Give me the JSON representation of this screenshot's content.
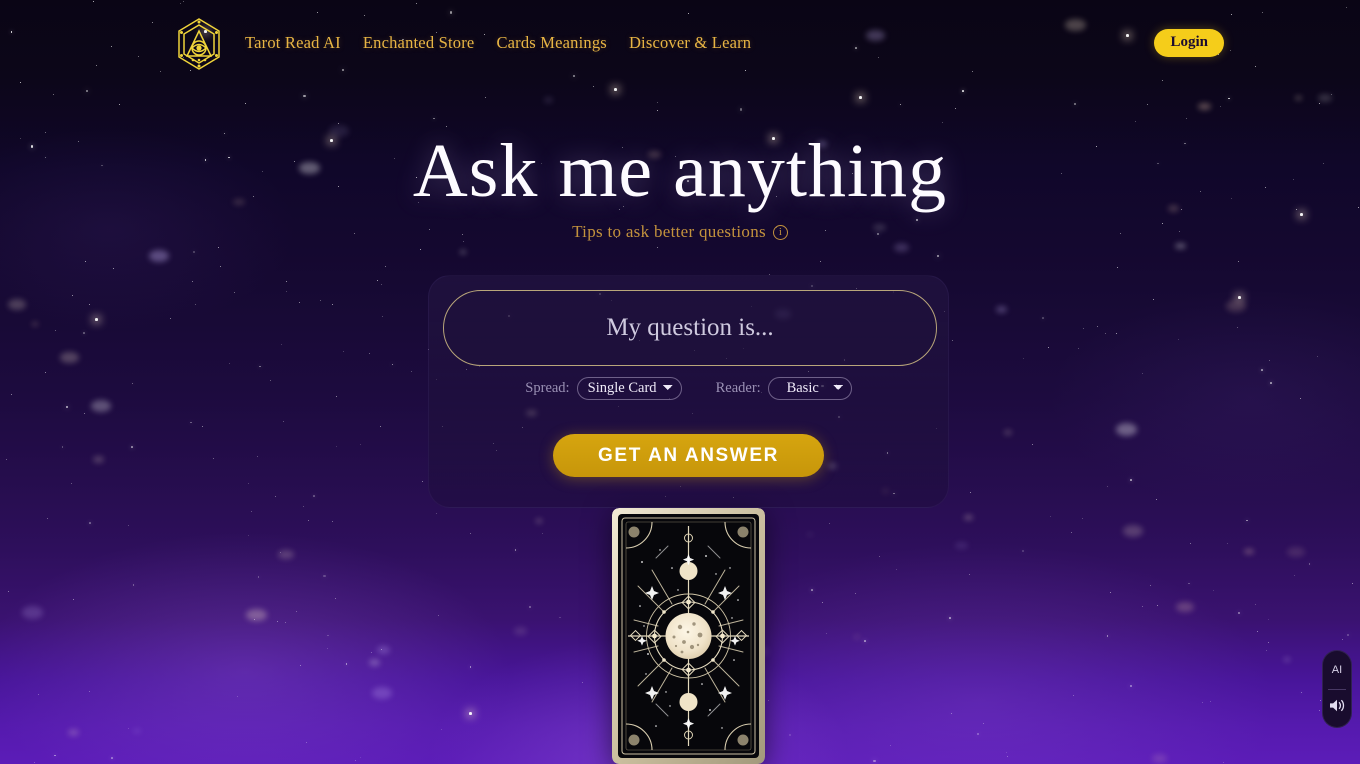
{
  "header": {
    "logo_icon": "hexagram-eye-logo-icon",
    "nav": [
      {
        "label": "Tarot Read AI"
      },
      {
        "label": "Enchanted Store"
      },
      {
        "label": "Cards Meanings"
      },
      {
        "label": "Discover & Learn"
      }
    ],
    "login_label": "Login"
  },
  "hero": {
    "title": "Ask me anything",
    "tips_label": "Tips to ask better questions",
    "tips_icon_glyph": "i"
  },
  "form": {
    "question_placeholder": "My question is...",
    "question_value": "",
    "spread_label": "Spread:",
    "spread_value": "Single Card",
    "spread_options": [
      "Single Card"
    ],
    "reader_label": "Reader:",
    "reader_value": "Basic",
    "reader_options": [
      "Basic"
    ],
    "submit_label": "GET AN ANSWER"
  },
  "card": {
    "face": "card-back",
    "alt": "Tarot card back with celestial moon and star motif"
  },
  "widget": {
    "ai_label": "AI",
    "sound_icon": "speaker-icon"
  },
  "colors": {
    "accent_gold": "#e8b544",
    "login_yellow": "#f5cd1a",
    "button_gold": "#d6a50f",
    "title_white": "#fdfbff",
    "tips_gold": "#c3923d",
    "sky_top": "#0a0515",
    "sky_bottom": "#5c1cb8"
  }
}
